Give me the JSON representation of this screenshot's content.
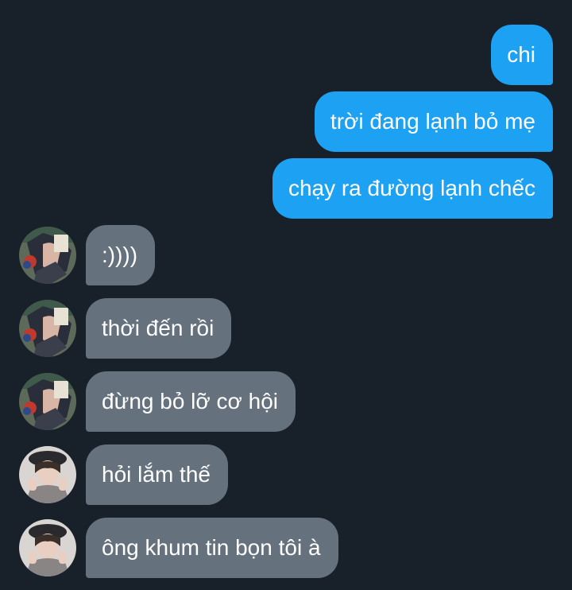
{
  "colors": {
    "background": "#18202a",
    "sent_bubble": "#1da1f2",
    "received_bubble": "#66717e",
    "text": "#ffffff"
  },
  "messages": [
    {
      "direction": "sent",
      "text": "chi"
    },
    {
      "direction": "sent",
      "text": "trời đang lạnh bỏ mẹ"
    },
    {
      "direction": "sent",
      "text": "chạy ra đường lạnh chếc"
    },
    {
      "direction": "received",
      "avatar": "anime-character-avatar",
      "text": ":))))"
    },
    {
      "direction": "received",
      "avatar": "anime-character-avatar",
      "text": "thời đến rồi"
    },
    {
      "direction": "received",
      "avatar": "anime-character-avatar",
      "text": "đừng bỏ lỡ cơ hội"
    },
    {
      "direction": "received",
      "avatar": "person-beret-avatar",
      "text": "hỏi lắm thế"
    },
    {
      "direction": "received",
      "avatar": "person-beret-avatar",
      "text": "ông khum tin bọn tôi à"
    }
  ]
}
